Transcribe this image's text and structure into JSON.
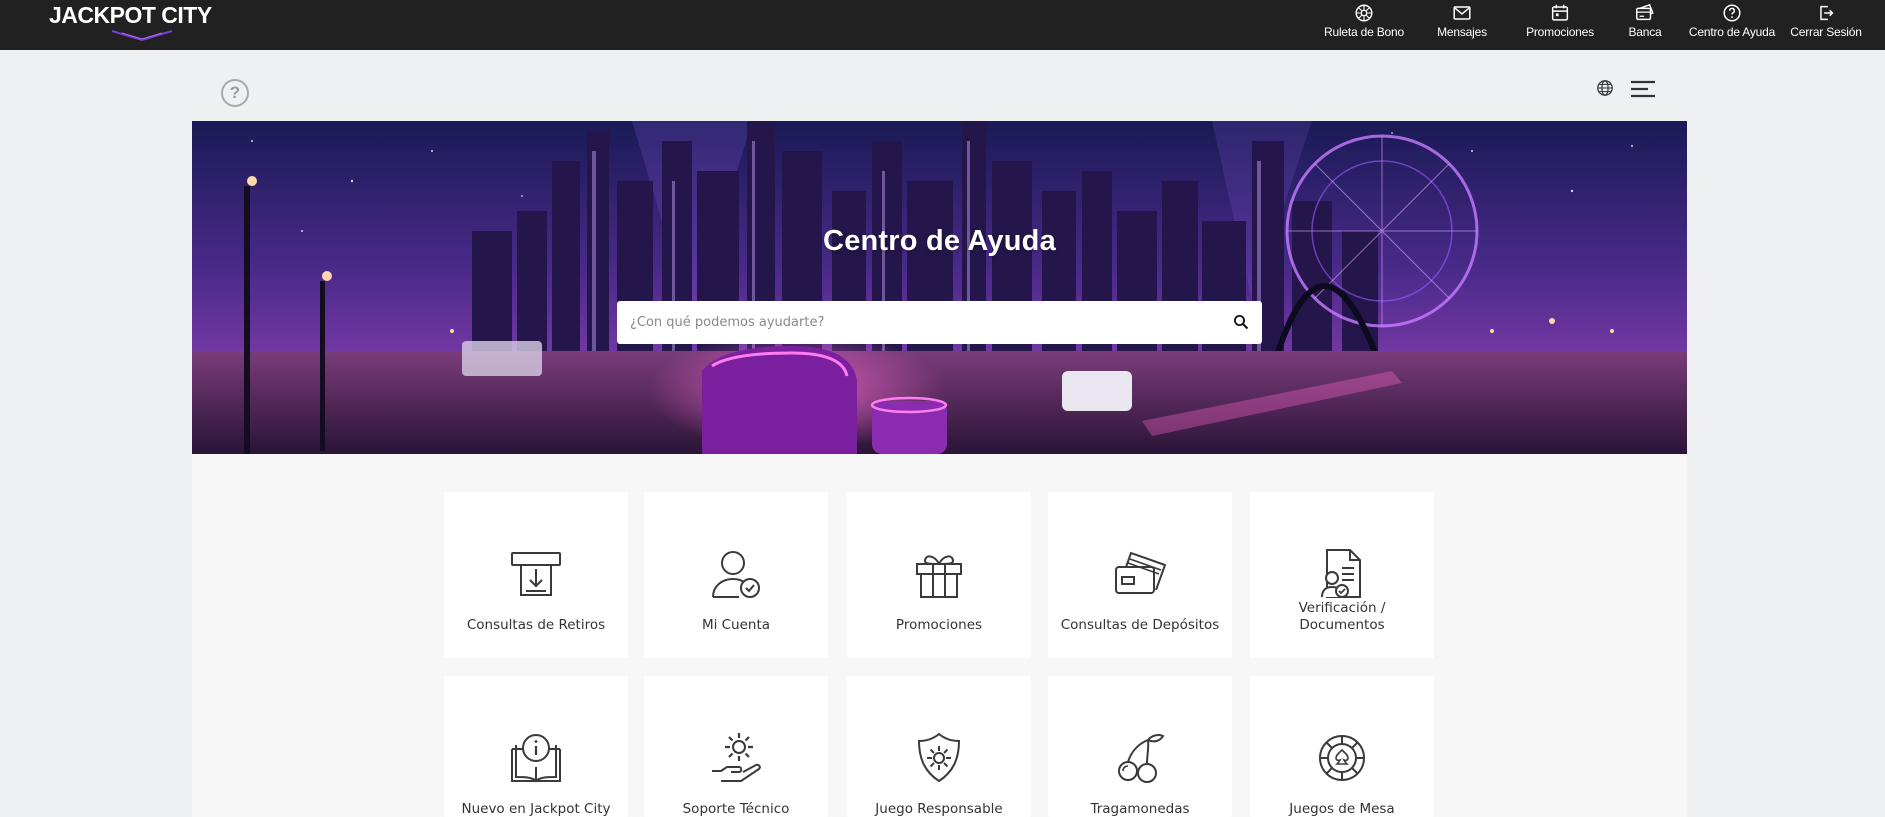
{
  "header": {
    "logo_text": "JACKPOT CITY",
    "nav": [
      {
        "icon": "roulette-wheel-icon",
        "label": "Ruleta de Bono"
      },
      {
        "icon": "envelope-icon",
        "label": "Mensajes"
      },
      {
        "icon": "calendar-icon",
        "label": "Promociones"
      },
      {
        "icon": "wallet-card-icon",
        "label": "Banca"
      },
      {
        "icon": "question-circle-icon",
        "label": "Centro de Ayuda"
      },
      {
        "icon": "logout-icon",
        "label": "Cerrar Sesión"
      }
    ]
  },
  "help_glyph": "?",
  "hero": {
    "title": "Centro de Ayuda",
    "search_placeholder": "¿Con qué podemos ayudarte?"
  },
  "categories": [
    {
      "label": "Consultas de Retiros",
      "icon": "withdrawal-atm-icon"
    },
    {
      "label": "Mi Cuenta",
      "icon": "user-check-icon"
    },
    {
      "label": "Promociones",
      "icon": "gift-icon"
    },
    {
      "label": "Consultas de Depósitos",
      "icon": "credit-cards-icon"
    },
    {
      "label": "Verificación / Documentos",
      "icon": "document-verified-icon"
    },
    {
      "label": "Nuevo en Jackpot City",
      "icon": "info-book-icon"
    },
    {
      "label": "Soporte Técnico",
      "icon": "gear-hand-icon"
    },
    {
      "label": "Juego Responsable",
      "icon": "shield-gear-icon"
    },
    {
      "label": "Tragamonedas",
      "icon": "cherries-icon"
    },
    {
      "label": "Juegos de Mesa",
      "icon": "casino-chip-icon"
    }
  ],
  "colors": {
    "topbar": "#212121",
    "page_bg": "#eef0f2",
    "hero_purple": "#7b2fbe",
    "accent_pink": "#e040fb"
  }
}
